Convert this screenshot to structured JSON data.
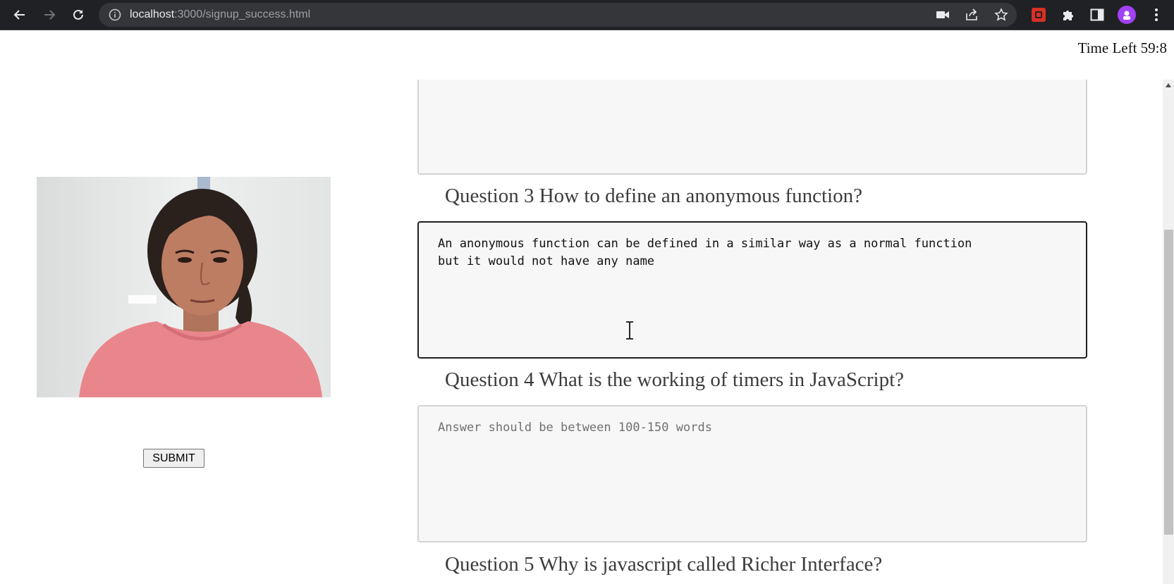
{
  "browser": {
    "url_host": "localhost",
    "url_path": ":3000/signup_success.html",
    "icons": {
      "back": "arrow-left-icon",
      "forward": "arrow-right-icon",
      "reload": "reload-icon",
      "site_info": "info-icon",
      "camera": "camera-icon",
      "share": "share-icon",
      "bookmark": "star-icon",
      "extension_red": "extension-icon",
      "extensions": "puzzle-icon",
      "side_panel": "side-panel-icon",
      "profile": "avatar-icon",
      "menu": "kebab-menu-icon"
    }
  },
  "timer": {
    "text": "Time Left 59:8"
  },
  "webcam": {
    "description_icon": "webcam-feed"
  },
  "submit": {
    "label": "SUBMIT"
  },
  "questions": [
    {
      "title": "Question 3 How to define an anonymous function?",
      "answer_line1": "An anonymous function can be defined in a similar way as a normal function",
      "answer_line2": "but it would not have any name"
    },
    {
      "title": "Question 4 What is the working of timers in JavaScript?",
      "placeholder": "Answer should be between 100-150 words"
    },
    {
      "title": "Question 5 Why is javascript called Richer Interface?"
    }
  ],
  "colors": {
    "chrome_bg": "#202124",
    "omnibox_bg": "#35363a",
    "textarea_bg": "#f7f7f7",
    "scroll_thumb": "#c1c1c1"
  }
}
